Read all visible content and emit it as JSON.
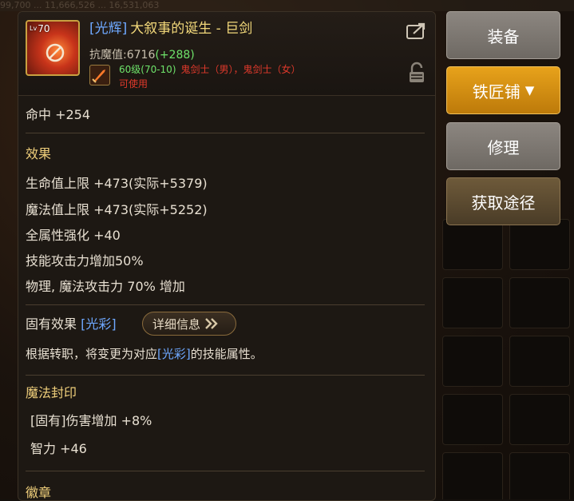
{
  "background": {
    "top_stats": "99,700 ...   11,666,526   ...   16,531,063"
  },
  "item": {
    "level_badge": "70",
    "level_prefix": "Lv",
    "name_tag": "[光辉]",
    "name": "大叙事的诞生 - 巨剑",
    "resist_label": "抗魔值:",
    "resist_value": "6716",
    "resist_bonus": "(+288)",
    "level_req": "60级(70-10)",
    "class_req": "鬼剑士（男），鬼剑士（女）",
    "usable": "可使用"
  },
  "stats": {
    "accuracy": "命中 +254",
    "effects_title": "效果",
    "hp": "生命值上限 +473(实际+5379)",
    "mp": "魔法值上限 +473(实际+5252)",
    "all_stats": "全属性强化 +40",
    "skill_atk": "技能攻击力增加50%",
    "phys_mag_atk": "物理, 魔法攻击力 70% 增加"
  },
  "inherent": {
    "title": "固有效果",
    "tag": "[光彩]",
    "detail_button": "详细信息",
    "desc_prefix": "根据转职，将变更为对应",
    "desc_tag": "[光彩]",
    "desc_suffix": "的技能属性。"
  },
  "seal": {
    "title": "魔法封印",
    "line1": "[固有]伤害增加 +8%",
    "line2": "智力 +46"
  },
  "emblem": {
    "title": "徽章"
  },
  "actions": {
    "equip": "装备",
    "blacksmith": "铁匠铺",
    "repair": "修理",
    "source": "获取途径"
  },
  "colors": {
    "tag_blue": "#6ea8ff",
    "name_gold": "#f2d87a",
    "bonus_green": "#6ee36a",
    "req_red": "#e0392b",
    "section_gold": "#f0cf7b",
    "button_gold": "#e7a21b",
    "button_grey": "#8c8680"
  }
}
